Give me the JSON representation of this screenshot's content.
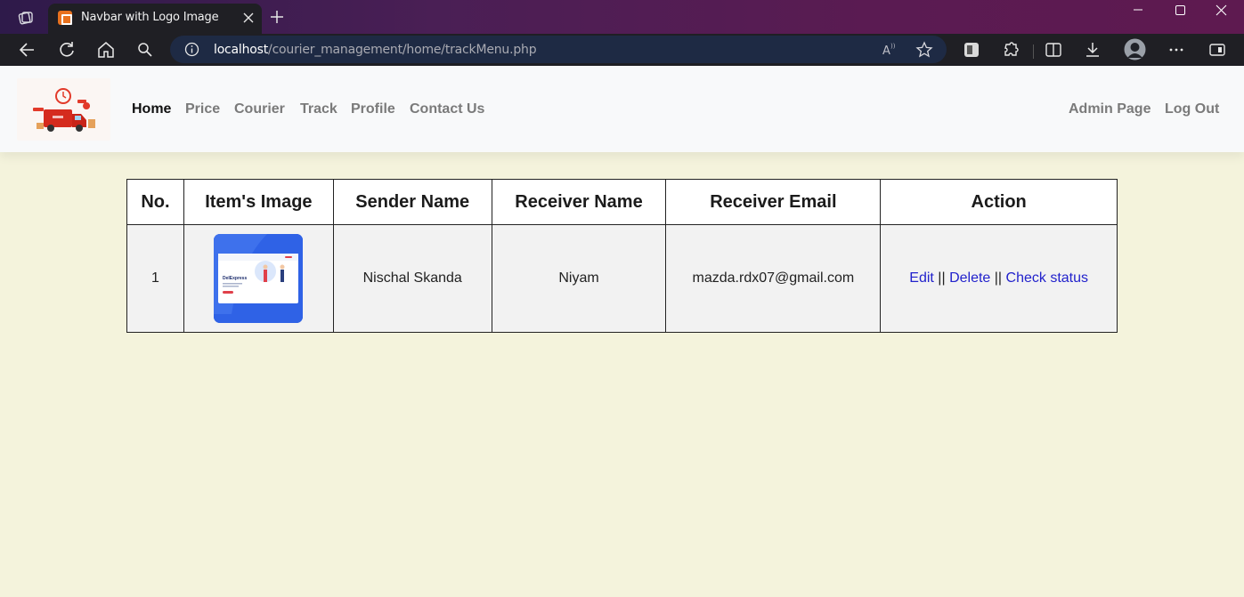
{
  "browser": {
    "tab_title": "Navbar with Logo Image",
    "url_host": "localhost",
    "url_path": "/courier_management/home/trackMenu.php"
  },
  "navbar": {
    "left_links": [
      "Home",
      "Price",
      "Courier",
      "Track",
      "Profile",
      "Contact Us"
    ],
    "active": "Home",
    "right_links": [
      "Admin Page",
      "Log Out"
    ]
  },
  "table": {
    "headers": [
      "No.",
      "Item's Image",
      "Sender Name",
      "Receiver Name",
      "Receiver Email",
      "Action"
    ],
    "rows": [
      {
        "no": "1",
        "sender": "Nischal Skanda",
        "receiver": "Niyam",
        "email": "mazda.rdx07@gmail.com",
        "actions": [
          "Edit",
          "Delete",
          "Check status"
        ],
        "separator": "||"
      }
    ]
  },
  "colors": {
    "page_bg": "#f4f3dc",
    "navbar_bg": "#f8f9fa",
    "link": "#2222cc",
    "cell_bg": "#f2f2f2"
  }
}
